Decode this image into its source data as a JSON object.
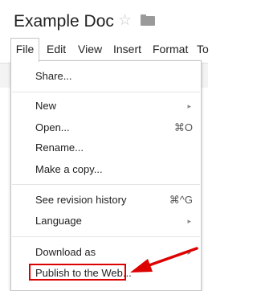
{
  "document": {
    "title": "Example Doc"
  },
  "icons": {
    "star": "star-icon",
    "folder": "folder-icon",
    "submenu": "submenu-arrow-icon"
  },
  "menubar": {
    "items": [
      {
        "label": "File"
      },
      {
        "label": "Edit"
      },
      {
        "label": "View"
      },
      {
        "label": "Insert"
      },
      {
        "label": "Format"
      },
      {
        "label": "To"
      }
    ]
  },
  "file_menu": {
    "share": {
      "label": "Share..."
    },
    "new": {
      "label": "New",
      "submenu_arrow": "▸"
    },
    "open": {
      "label": "Open...",
      "shortcut": "⌘O"
    },
    "rename": {
      "label": "Rename..."
    },
    "copy": {
      "label": "Make a copy..."
    },
    "revision": {
      "label": "See revision history",
      "shortcut": "⌘^G"
    },
    "language": {
      "label": "Language",
      "submenu_arrow": "▸"
    },
    "download": {
      "label": "Download as",
      "submenu_arrow": "▸"
    },
    "publish": {
      "label": "Publish to the Web..."
    }
  },
  "annotation": {
    "color": "#dd0000"
  }
}
